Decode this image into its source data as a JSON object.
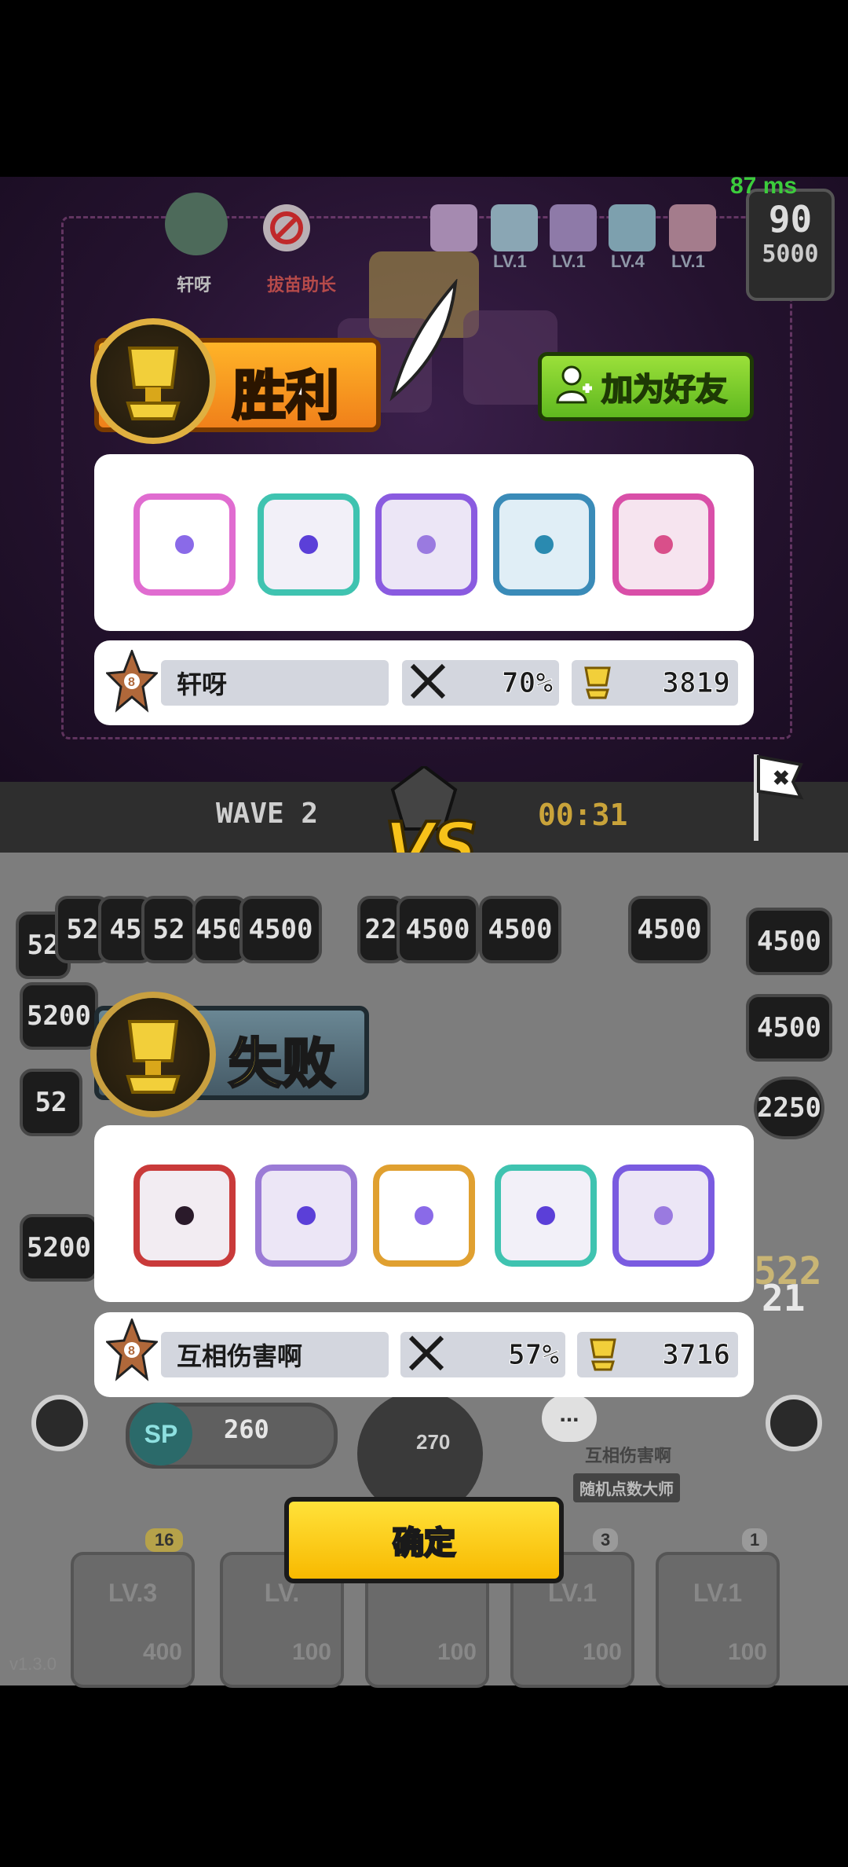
{
  "colors": {
    "victory_banner": "#f0801a",
    "defeat_banner": "#455a66",
    "add_friend": "#5fb81f",
    "confirm_button": "#f8b900",
    "ping_green": "#3ccc3c",
    "timer_gold": "#c9a33a"
  },
  "top_hud": {
    "ping": "87 ms",
    "player_name": "轩呀",
    "mode_label": "拔苗助长",
    "dice_levels": [
      "",
      "LV.1",
      "LV.1",
      "LV.4",
      "LV.1"
    ],
    "wave_count": "90",
    "sp_top": "5000"
  },
  "victory": {
    "banner_label": "胜利",
    "add_friend_label": "加为好友",
    "dice_icons": [
      "rainbow-infinity-dice",
      "teal-hands-dice",
      "purple-dice",
      "blue-whirl-dice",
      "pink-cross-dice"
    ],
    "player": {
      "rank": "8",
      "name": "轩呀",
      "win_rate": "70%",
      "trophies": "3819"
    }
  },
  "wave_bar": {
    "wave_label": "WAVE 2",
    "timer": "00:31",
    "vs_label": "VS"
  },
  "defeat": {
    "banner_label": "失败",
    "dice_icons": [
      "red-saw-dice",
      "purple-crack-dice",
      "rainbow-infinity-dice",
      "teal-hands-dice",
      "violet-dice"
    ],
    "player": {
      "rank": "8",
      "name": "互相伤害啊",
      "win_rate": "57%",
      "trophies": "3716"
    }
  },
  "bottom_field": {
    "tiles_row1": [
      "52",
      "52",
      "45",
      "52",
      "450",
      "4500",
      "22",
      "4500",
      "4500",
      "4500",
      "4500"
    ],
    "tiles_right": [
      "4500",
      "2250"
    ],
    "tiles_left": [
      "5200",
      "52",
      "5200"
    ],
    "sp_label": "SP",
    "sp_value": "260",
    "spawn_cost": "270",
    "score_side": [
      "522",
      "21"
    ],
    "opponent_name": "互相伤害啊",
    "opponent_title": "随机点数大师",
    "chat_label": "...",
    "deck": [
      {
        "level": "LV.3",
        "count": "16",
        "cost": "400"
      },
      {
        "level": "LV.",
        "count": "",
        "cost": "100"
      },
      {
        "level": "",
        "count": "",
        "cost": "100"
      },
      {
        "level": "LV.1",
        "count": "3",
        "cost": "100"
      },
      {
        "level": "LV.1",
        "count": "1",
        "cost": "100"
      }
    ],
    "version": "v1.3.0"
  },
  "confirm_label": "确定"
}
